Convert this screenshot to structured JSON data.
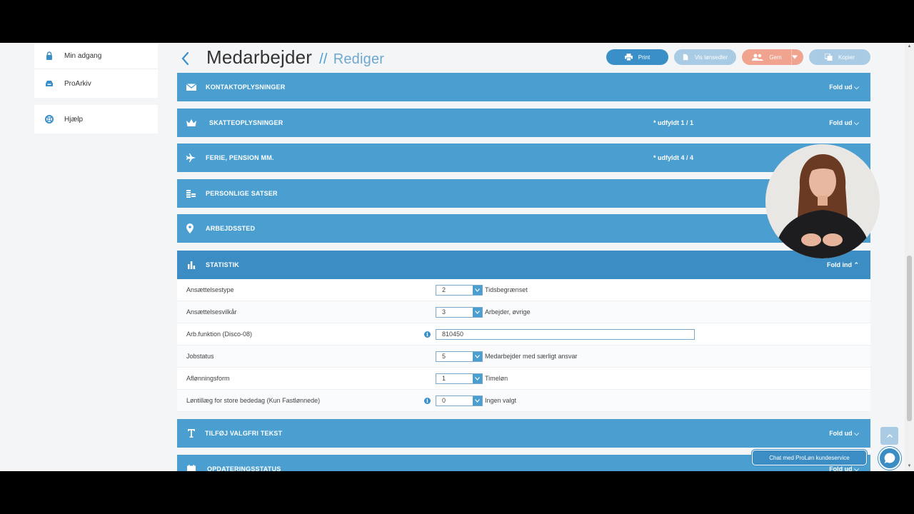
{
  "sidebar": {
    "items": [
      {
        "label": "Min adgang",
        "icon": "lock-icon"
      },
      {
        "label": "ProArkiv",
        "icon": "archive-icon"
      },
      {
        "label": "Hjælp",
        "icon": "lifebuoy-icon"
      }
    ]
  },
  "header": {
    "title": "Medarbejder",
    "separator": "//",
    "subtitle": "Rediger",
    "buttons": {
      "print": "Print",
      "vis": "Vis lønsedler",
      "gem": "Gem",
      "kopier": "Kopier"
    }
  },
  "panels": [
    {
      "title": "KONTAKTOPLYSNINGER",
      "status": "",
      "fold": "Fold ud ⌵",
      "icon": "envelope-icon"
    },
    {
      "title": "SKATTEOPLYSNINGER",
      "status": "* udfyldt 1 / 1",
      "fold": "Fold ud ⌵",
      "icon": "crown-icon"
    },
    {
      "title": "FERIE, PENSION MM.",
      "status": "* udfyldt 4 / 4",
      "fold": "",
      "icon": "plane-icon"
    },
    {
      "title": "PERSONLIGE SATSER",
      "status": "",
      "fold": "",
      "icon": "coins-icon"
    },
    {
      "title": "ARBEJDSSTED",
      "status": "",
      "fold": "",
      "icon": "map-pin-icon"
    },
    {
      "title": "STATISTIK",
      "status": "",
      "fold": "Fold ind ⌃",
      "icon": "bar-chart-icon"
    },
    {
      "title": "TILFØJ VALGFRI TEKST",
      "status": "",
      "fold": "Fold ud ⌵",
      "icon": "text-icon"
    },
    {
      "title": "OPDATERINGSSTATUS",
      "status": "",
      "fold": "Fold ud ⌵",
      "icon": "calendar-icon"
    }
  ],
  "statistik": {
    "rows": [
      {
        "label": "Ansættelsestype",
        "value": "2",
        "desc": "Tidsbegrænset"
      },
      {
        "label": "Ansættelsesvilkår",
        "value": "3",
        "desc": "Arbejder, øvrige"
      },
      {
        "label": "Arb.funktion (Disco-08)",
        "value": "810450",
        "desc": ""
      },
      {
        "label": "Jobstatus",
        "value": "5",
        "desc": "Medarbejder med særligt ansvar"
      },
      {
        "label": "Aflønningsform",
        "value": "1",
        "desc": "Timeløn"
      },
      {
        "label": "Løntillæg for store bededag (Kun Fastlønnede)",
        "value": "0",
        "desc": "Ingen valgt"
      }
    ]
  },
  "chat": {
    "label": "Chat med ProLøn kundeservice"
  },
  "colors": {
    "panel": "#4a9fd0",
    "panel_open": "#3b8dc3",
    "accent": "#3b8fc9",
    "gem": "#f0a38f"
  }
}
